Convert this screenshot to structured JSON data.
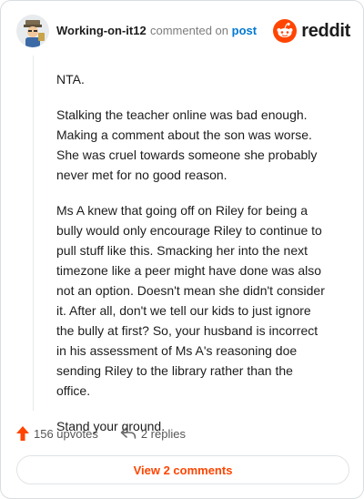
{
  "comment": {
    "username": "Working-on-it12",
    "commented_on_text": "commented on",
    "post_link": "post",
    "paragraphs": [
      "NTA.",
      "Stalking the teacher online was bad enough. Making a comment about the son was worse. She was cruel towards someone she probably never met for no good reason.",
      "Ms A knew that going off on Riley for being a bully would only encourage Riley to continue to pull stuff like this. Smacking her into the next timezone like a peer might have done was also not an option. Doesn't mean she didn't consider it. After all, don't we tell our kids to just ignore the bully at first? So, your husband is incorrect in his assessment of Ms A's reasoning doe sending Riley to the library rather than the office.",
      "Stand your ground."
    ]
  },
  "brand": {
    "wordmark": "reddit",
    "color": "#ff4500"
  },
  "actions": {
    "upvotes_label": "156 upvotes",
    "replies_label": "2 replies",
    "upvote_icon": "upvote-arrow-icon",
    "reply_icon": "reply-arrow-icon"
  },
  "view_comments_label": "View 2 comments"
}
